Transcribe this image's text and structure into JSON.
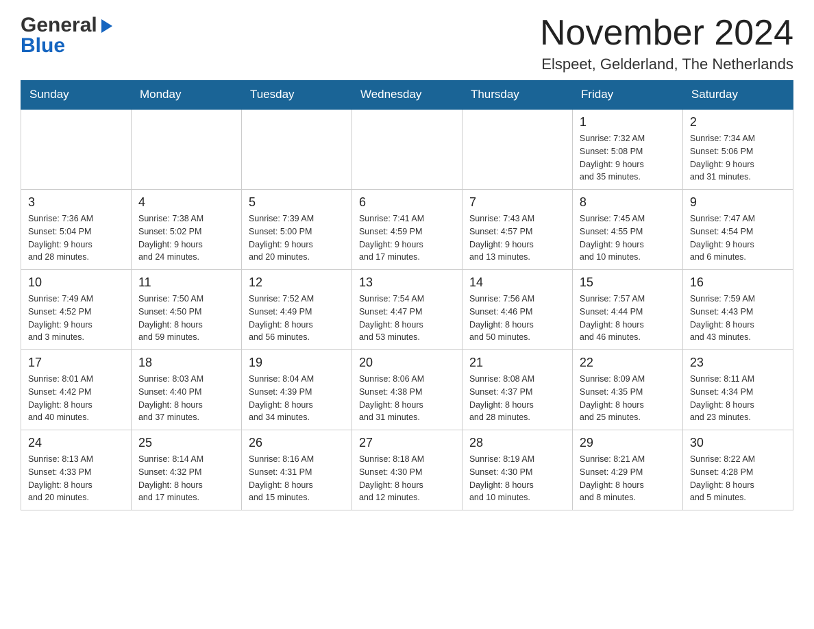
{
  "header": {
    "logo_general": "General",
    "logo_blue": "Blue",
    "month_title": "November 2024",
    "location": "Elspeet, Gelderland, The Netherlands"
  },
  "weekdays": [
    "Sunday",
    "Monday",
    "Tuesday",
    "Wednesday",
    "Thursday",
    "Friday",
    "Saturday"
  ],
  "weeks": [
    {
      "days": [
        {
          "num": "",
          "info": ""
        },
        {
          "num": "",
          "info": ""
        },
        {
          "num": "",
          "info": ""
        },
        {
          "num": "",
          "info": ""
        },
        {
          "num": "",
          "info": ""
        },
        {
          "num": "1",
          "info": "Sunrise: 7:32 AM\nSunset: 5:08 PM\nDaylight: 9 hours\nand 35 minutes."
        },
        {
          "num": "2",
          "info": "Sunrise: 7:34 AM\nSunset: 5:06 PM\nDaylight: 9 hours\nand 31 minutes."
        }
      ]
    },
    {
      "days": [
        {
          "num": "3",
          "info": "Sunrise: 7:36 AM\nSunset: 5:04 PM\nDaylight: 9 hours\nand 28 minutes."
        },
        {
          "num": "4",
          "info": "Sunrise: 7:38 AM\nSunset: 5:02 PM\nDaylight: 9 hours\nand 24 minutes."
        },
        {
          "num": "5",
          "info": "Sunrise: 7:39 AM\nSunset: 5:00 PM\nDaylight: 9 hours\nand 20 minutes."
        },
        {
          "num": "6",
          "info": "Sunrise: 7:41 AM\nSunset: 4:59 PM\nDaylight: 9 hours\nand 17 minutes."
        },
        {
          "num": "7",
          "info": "Sunrise: 7:43 AM\nSunset: 4:57 PM\nDaylight: 9 hours\nand 13 minutes."
        },
        {
          "num": "8",
          "info": "Sunrise: 7:45 AM\nSunset: 4:55 PM\nDaylight: 9 hours\nand 10 minutes."
        },
        {
          "num": "9",
          "info": "Sunrise: 7:47 AM\nSunset: 4:54 PM\nDaylight: 9 hours\nand 6 minutes."
        }
      ]
    },
    {
      "days": [
        {
          "num": "10",
          "info": "Sunrise: 7:49 AM\nSunset: 4:52 PM\nDaylight: 9 hours\nand 3 minutes."
        },
        {
          "num": "11",
          "info": "Sunrise: 7:50 AM\nSunset: 4:50 PM\nDaylight: 8 hours\nand 59 minutes."
        },
        {
          "num": "12",
          "info": "Sunrise: 7:52 AM\nSunset: 4:49 PM\nDaylight: 8 hours\nand 56 minutes."
        },
        {
          "num": "13",
          "info": "Sunrise: 7:54 AM\nSunset: 4:47 PM\nDaylight: 8 hours\nand 53 minutes."
        },
        {
          "num": "14",
          "info": "Sunrise: 7:56 AM\nSunset: 4:46 PM\nDaylight: 8 hours\nand 50 minutes."
        },
        {
          "num": "15",
          "info": "Sunrise: 7:57 AM\nSunset: 4:44 PM\nDaylight: 8 hours\nand 46 minutes."
        },
        {
          "num": "16",
          "info": "Sunrise: 7:59 AM\nSunset: 4:43 PM\nDaylight: 8 hours\nand 43 minutes."
        }
      ]
    },
    {
      "days": [
        {
          "num": "17",
          "info": "Sunrise: 8:01 AM\nSunset: 4:42 PM\nDaylight: 8 hours\nand 40 minutes."
        },
        {
          "num": "18",
          "info": "Sunrise: 8:03 AM\nSunset: 4:40 PM\nDaylight: 8 hours\nand 37 minutes."
        },
        {
          "num": "19",
          "info": "Sunrise: 8:04 AM\nSunset: 4:39 PM\nDaylight: 8 hours\nand 34 minutes."
        },
        {
          "num": "20",
          "info": "Sunrise: 8:06 AM\nSunset: 4:38 PM\nDaylight: 8 hours\nand 31 minutes."
        },
        {
          "num": "21",
          "info": "Sunrise: 8:08 AM\nSunset: 4:37 PM\nDaylight: 8 hours\nand 28 minutes."
        },
        {
          "num": "22",
          "info": "Sunrise: 8:09 AM\nSunset: 4:35 PM\nDaylight: 8 hours\nand 25 minutes."
        },
        {
          "num": "23",
          "info": "Sunrise: 8:11 AM\nSunset: 4:34 PM\nDaylight: 8 hours\nand 23 minutes."
        }
      ]
    },
    {
      "days": [
        {
          "num": "24",
          "info": "Sunrise: 8:13 AM\nSunset: 4:33 PM\nDaylight: 8 hours\nand 20 minutes."
        },
        {
          "num": "25",
          "info": "Sunrise: 8:14 AM\nSunset: 4:32 PM\nDaylight: 8 hours\nand 17 minutes."
        },
        {
          "num": "26",
          "info": "Sunrise: 8:16 AM\nSunset: 4:31 PM\nDaylight: 8 hours\nand 15 minutes."
        },
        {
          "num": "27",
          "info": "Sunrise: 8:18 AM\nSunset: 4:30 PM\nDaylight: 8 hours\nand 12 minutes."
        },
        {
          "num": "28",
          "info": "Sunrise: 8:19 AM\nSunset: 4:30 PM\nDaylight: 8 hours\nand 10 minutes."
        },
        {
          "num": "29",
          "info": "Sunrise: 8:21 AM\nSunset: 4:29 PM\nDaylight: 8 hours\nand 8 minutes."
        },
        {
          "num": "30",
          "info": "Sunrise: 8:22 AM\nSunset: 4:28 PM\nDaylight: 8 hours\nand 5 minutes."
        }
      ]
    }
  ]
}
